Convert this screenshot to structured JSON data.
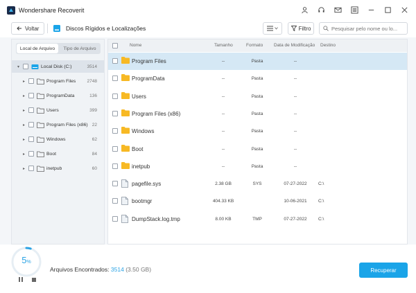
{
  "app": {
    "title": "Wondershare Recoverit"
  },
  "toolbar": {
    "back_label": "Voltar",
    "location_title": "Discos Rígidos e Localizações",
    "filter_label": "Filtro",
    "search_placeholder": "Pesquisar pelo nome ou lo..."
  },
  "left_tabs": [
    "Local de Arquivo",
    "Tipo de Arquivo"
  ],
  "tree": {
    "root": {
      "label": "Local Disk (C:)",
      "count": "3514"
    },
    "items": [
      {
        "label": "Program Files",
        "count": "2748"
      },
      {
        "label": "ProgramData",
        "count": "136"
      },
      {
        "label": "Users",
        "count": "399"
      },
      {
        "label": "Program Files (x86)",
        "count": "22"
      },
      {
        "label": "Windows",
        "count": "62"
      },
      {
        "label": "Boot",
        "count": "84"
      },
      {
        "label": "inetpub",
        "count": "60"
      }
    ]
  },
  "table": {
    "headers": {
      "name": "Nome",
      "size": "Tamanho",
      "type": "Formato",
      "date": "Data de Modificação",
      "dest": "Destino"
    },
    "rows": [
      {
        "name": "Program Files",
        "size": "--",
        "type": "Pasta",
        "date": "--",
        "dest": "",
        "icon": "folder-icon"
      },
      {
        "name": "ProgramData",
        "size": "--",
        "type": "Pasta",
        "date": "--",
        "dest": "",
        "icon": "folder-icon"
      },
      {
        "name": "Users",
        "size": "--",
        "type": "Pasta",
        "date": "--",
        "dest": "",
        "icon": "folder-icon"
      },
      {
        "name": "Program Files (x86)",
        "size": "--",
        "type": "Pasta",
        "date": "--",
        "dest": "",
        "icon": "folder-icon"
      },
      {
        "name": "Windows",
        "size": "--",
        "type": "Pasta",
        "date": "--",
        "dest": "",
        "icon": "folder-icon"
      },
      {
        "name": "Boot",
        "size": "--",
        "type": "Pasta",
        "date": "--",
        "dest": "",
        "icon": "folder-icon"
      },
      {
        "name": "inetpub",
        "size": "--",
        "type": "Pasta",
        "date": "--",
        "dest": "",
        "icon": "folder-icon"
      },
      {
        "name": "pagefile.sys",
        "size": "2.38 GB",
        "type": "SYS",
        "date": "07-27-2022",
        "dest": "C:\\",
        "icon": "file-icon"
      },
      {
        "name": "bootmgr",
        "size": "404.33 KB",
        "type": "",
        "date": "10-06-2021",
        "dest": "C:\\",
        "icon": "file-icon"
      },
      {
        "name": "DumpStack.log.tmp",
        "size": "8.00 KB",
        "type": "TMP",
        "date": "07-27-2022",
        "dest": "C:\\",
        "icon": "file-icon"
      }
    ]
  },
  "footer": {
    "progress_value": "5",
    "progress_unit": "%",
    "progress_fraction": 0.05,
    "found_label": "Arquivos Encontrados:",
    "found_count": "3514",
    "found_size": "(3.50 GB)",
    "recover_label": "Recuperar"
  },
  "colors": {
    "accent": "#1aa4e8",
    "folder": "#f7b924",
    "selected_row": "#d5e8f5"
  }
}
